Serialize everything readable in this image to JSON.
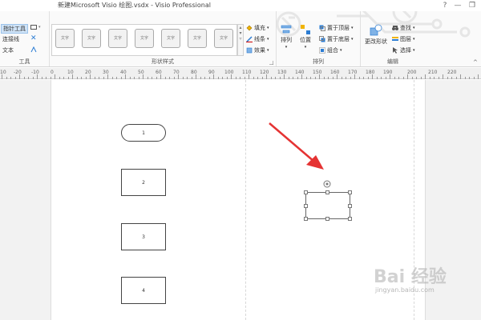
{
  "window": {
    "title": "新建Microsoft Visio 绘图.vsdx - Visio Professional",
    "help": "?",
    "minimize": "—",
    "restore": "❐"
  },
  "ribbon": {
    "tools_group": {
      "label": "工具",
      "pointer_tool": "指针工具",
      "connector": "连接线",
      "text": "文本"
    },
    "shape_styles_group": {
      "label": "形状样式",
      "gallery": [
        "文字",
        "文字",
        "文字",
        "文字",
        "文字",
        "文字",
        "文字"
      ],
      "fill": "填充",
      "line": "线条",
      "effects": "效果"
    },
    "arrange_group": {
      "label": "排列",
      "align": "排列",
      "position": "位置",
      "bring_to_front": "置于顶层",
      "send_to_back": "置于底层",
      "group": "组合"
    },
    "edit_group": {
      "label": "编辑",
      "change_shape": "更改形状",
      "find": "查找",
      "layers": "图层",
      "select": "选择"
    }
  },
  "ruler": {
    "labels": [
      "10",
      "-20",
      "-10",
      "0",
      "10",
      "20",
      "30",
      "40",
      "50",
      "60",
      "70",
      "80",
      "90",
      "100",
      "110",
      "120",
      "130",
      "140",
      "150",
      "160",
      "170",
      "180",
      "190",
      "200",
      "210",
      "220"
    ]
  },
  "shapes": {
    "s1": "1",
    "s2": "2",
    "s3": "3",
    "s4": "4"
  },
  "watermark": {
    "main": "Bai 经验",
    "sub": "jingyan.baidu.com"
  },
  "colors": {
    "arrow": "#e53333",
    "selection": "#cfe3f7",
    "accent": "#2b7cd3"
  }
}
